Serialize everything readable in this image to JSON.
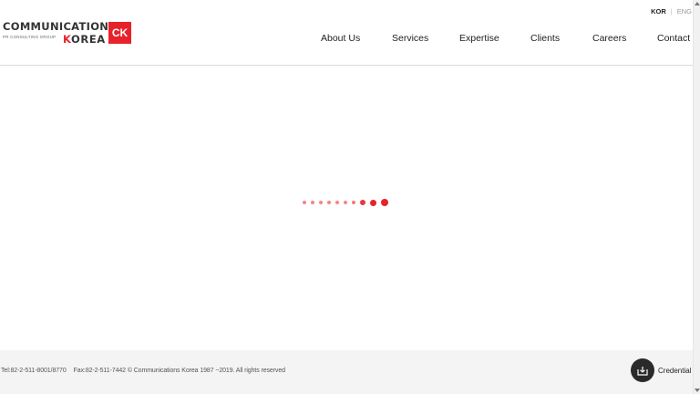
{
  "brand": {
    "line1": "COMMUNICATIONS",
    "line2": "PR CONSULTING GROUP",
    "line3_first": "K",
    "line3_rest": "OREA",
    "box": "CK",
    "accent_color": "#e8222b"
  },
  "language": {
    "active": "KOR",
    "separator": "|",
    "other": "ENG"
  },
  "nav": {
    "items": [
      {
        "label": "About Us"
      },
      {
        "label": "Services"
      },
      {
        "label": "Expertise"
      },
      {
        "label": "Clients"
      },
      {
        "label": "Careers"
      },
      {
        "label": "Contact"
      }
    ]
  },
  "loader": {
    "dot_count": 10
  },
  "footer": {
    "tel": "Tel:82-2-511-8001/8770",
    "fax": "Fax:82-2-511-7442",
    "copyright": "© Communications Korea 1987 ~2019. All rights reserved",
    "credential_label": "Credential",
    "credential_icon": "download-icon"
  }
}
